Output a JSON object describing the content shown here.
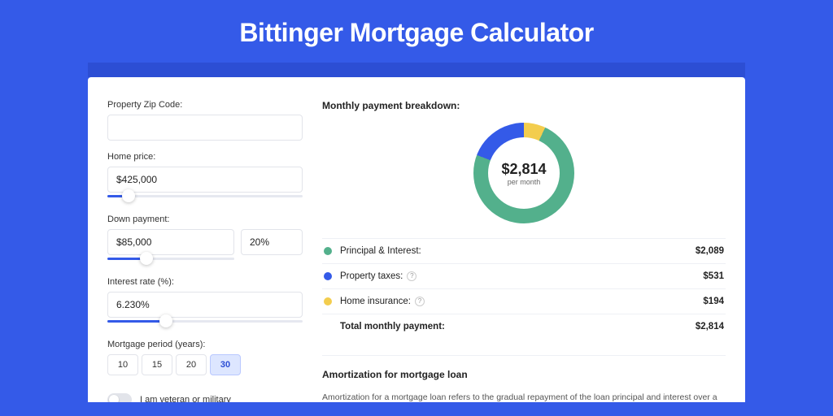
{
  "page": {
    "title": "Bittinger Mortgage Calculator"
  },
  "form": {
    "zip_label": "Property Zip Code:",
    "zip_value": "",
    "home_price_label": "Home price:",
    "home_price_value": "$425,000",
    "down_label": "Down payment:",
    "down_amount": "$85,000",
    "down_pct": "20%",
    "rate_label": "Interest rate (%):",
    "rate_value": "6.230%",
    "period_label": "Mortgage period (years):",
    "periods": [
      "10",
      "15",
      "20",
      "30"
    ],
    "period_selected": "30",
    "veteran_label": "I am veteran or military"
  },
  "breakdown": {
    "title": "Monthly payment breakdown:",
    "center_value": "$2,814",
    "center_sub": "per month",
    "rows": [
      {
        "name": "Principal & Interest:",
        "value": "$2,089",
        "color": "green",
        "hint": false
      },
      {
        "name": "Property taxes:",
        "value": "$531",
        "color": "blue",
        "hint": true
      },
      {
        "name": "Home insurance:",
        "value": "$194",
        "color": "yellow",
        "hint": true
      }
    ],
    "total_label": "Total monthly payment:",
    "total_value": "$2,814"
  },
  "amort": {
    "title": "Amortization for mortgage loan",
    "text": "Amortization for a mortgage loan refers to the gradual repayment of the loan principal and interest over a specified"
  },
  "chart_data": {
    "type": "pie",
    "title": "Monthly payment breakdown",
    "series": [
      {
        "name": "Principal & Interest",
        "value": 2089,
        "color": "#53b08c"
      },
      {
        "name": "Property taxes",
        "value": 531,
        "color": "#345ae8"
      },
      {
        "name": "Home insurance",
        "value": 194,
        "color": "#f3cd4e"
      }
    ],
    "total": 2814,
    "unit": "USD per month"
  }
}
